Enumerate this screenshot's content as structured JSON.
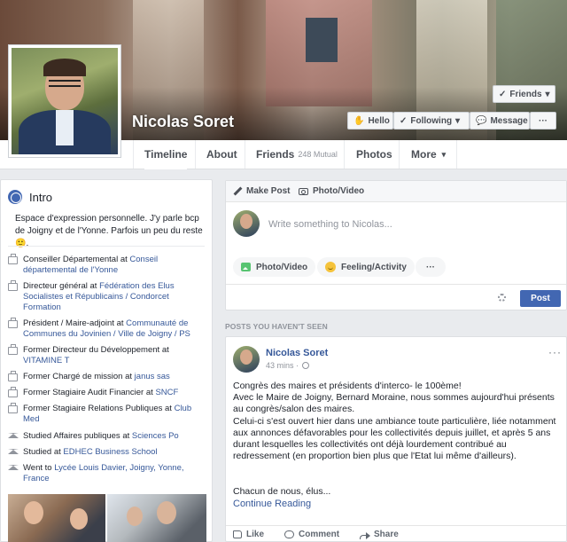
{
  "profile": {
    "name": "Nicolas Soret"
  },
  "cover_buttons": {
    "friends": "Friends",
    "hello": "Hello",
    "following": "Following",
    "message": "Message",
    "more": "···"
  },
  "nav": {
    "tabs": [
      {
        "label": "Timeline"
      },
      {
        "label": "About"
      },
      {
        "label": "Friends",
        "sub": "248 Mutual"
      },
      {
        "label": "Photos"
      },
      {
        "label": "More"
      }
    ],
    "more_chevron": "▾"
  },
  "intro": {
    "title": "Intro",
    "bio": "Espace d'expression personnelle. J'y parle bcp de Joigny et de l'Yonne. Parfois un peu du reste 🙂.",
    "items": [
      {
        "icon": "briefcase-icon",
        "text": "Conseiller Départemental at ",
        "link": "Conseil départemental de l'Yonne"
      },
      {
        "icon": "briefcase-icon",
        "text": "Directeur général at ",
        "link": "Fédération des Elus Socialistes et Républicains / Condorcet Formation"
      },
      {
        "icon": "briefcase-icon",
        "text": "Président / Maire-adjoint at ",
        "link": "Communauté de Communes du Jovinien / Ville de Joigny / PS"
      },
      {
        "icon": "briefcase-icon",
        "text": "Former Directeur du Développement at ",
        "link": "VITAMINE T"
      },
      {
        "icon": "briefcase-icon",
        "text": "Former Chargé de mission at ",
        "link": "janus sas"
      },
      {
        "icon": "briefcase-icon",
        "text": "Former Stagiaire Audit Financier at ",
        "link": "SNCF"
      },
      {
        "icon": "briefcase-icon",
        "text": "Former Stagiaire Relations Publiques at ",
        "link": "Club Med"
      },
      {
        "icon": "graduation-cap-icon",
        "text": "Studied Affaires publiques at ",
        "link": "Sciences Po"
      },
      {
        "icon": "graduation-cap-icon",
        "text": "Studied at ",
        "link": "EDHEC Business School"
      },
      {
        "icon": "graduation-cap-icon",
        "text": "Went to ",
        "link": "Lycée Louis Davier, Joigny, Yonne, France"
      }
    ]
  },
  "composer": {
    "make_post": "Make Post",
    "photo_video_tab": "Photo/Video",
    "placeholder": "Write something to Nicolas...",
    "photo_video": "Photo/Video",
    "feeling": "Feeling/Activity",
    "more": "···",
    "post": "Post"
  },
  "feed": {
    "section_label": "POSTS YOU HAVEN'T SEEN",
    "post": {
      "author": "Nicolas Soret",
      "time": "43 mins ·",
      "menu": "···",
      "text": "Congrès des maires et présidents d'interco- le 100ème!\nAvec le Maire de Joigny, Bernard Moraine, nous sommes aujourd'hui présents au congrès/salon des maires.\nCelui-ci s'est ouvert hier dans une ambiance toute particulière, liée notamment aux annonces défavorables pour les collectivités depuis juillet, et après 5 ans durant lesquelles les collectivités ont déjà lourdement contribué au redressement (en proportion bien plus que l'Etat lui même d'ailleurs).",
      "ellipsis": "Chacun de nous, élus...",
      "continue": "Continue Reading",
      "actions": {
        "like": "Like",
        "comment": "Comment",
        "share": "Share"
      }
    }
  },
  "colors": {
    "brand_blue": "#4267b2",
    "link_blue": "#365899",
    "page_bg": "#e9ebee"
  }
}
